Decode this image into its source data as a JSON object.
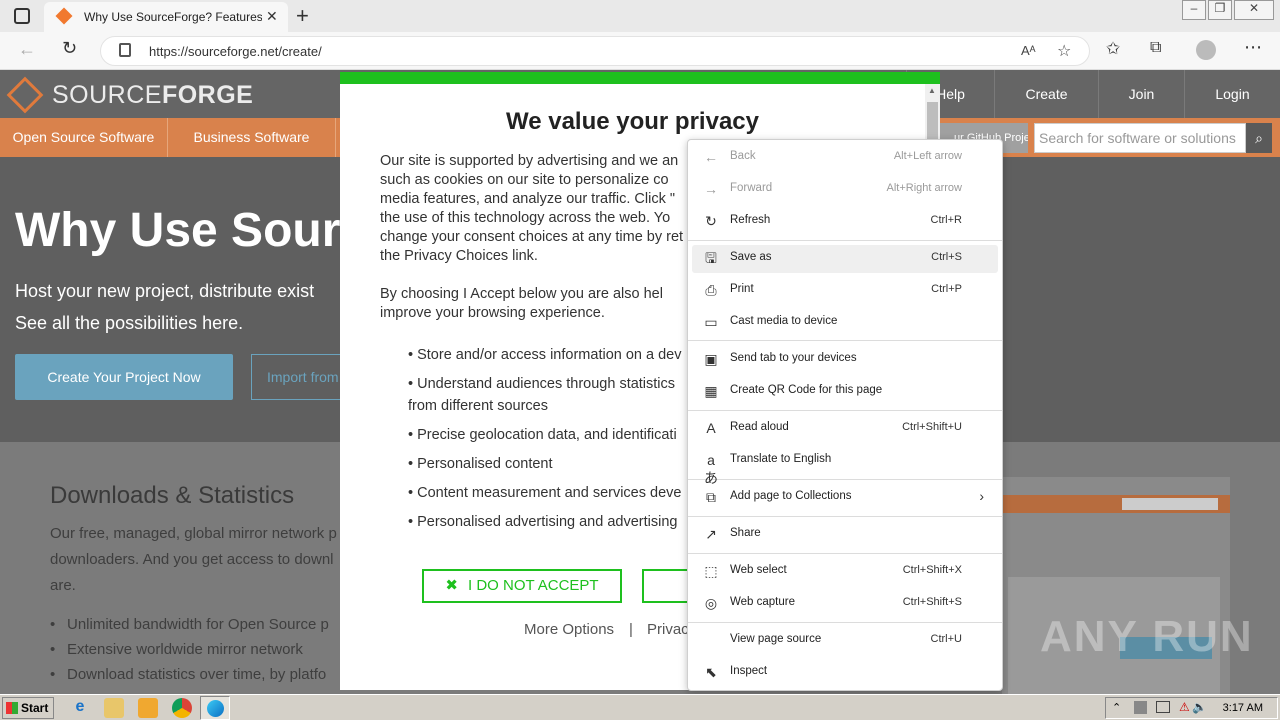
{
  "browser": {
    "tab_title": "Why Use SourceForge? Features a",
    "url": "https://sourceforge.net/create/"
  },
  "site": {
    "logo_text_light": "SOURCE",
    "logo_text_bold": "FORGE",
    "top_nav": [
      "Help",
      "Create",
      "Join",
      "Login"
    ],
    "orange_nav": [
      "Open Source Software",
      "Business Software"
    ],
    "github_project": "ur GitHub Project",
    "search_placeholder": "Search for software or solutions",
    "hero_title": "Why Use Sourc",
    "hero_line1": "Host your new project, distribute exist",
    "hero_line2": "See all the possibilities here.",
    "create_button": "Create Your Project Now",
    "import_button": "Import from",
    "downloads_title": "Downloads & Statistics",
    "downloads_text": [
      "Our free, managed, global mirror network p",
      "downloaders. And you get access to downl",
      "are."
    ],
    "bullets": [
      "Unlimited bandwidth for Open Source p",
      "Extensive worldwide mirror network",
      "Download statistics over time, by platfo"
    ]
  },
  "modal": {
    "title": "We value your privacy",
    "paragraph1": [
      "Our site is supported by advertising and we an",
      "such as cookies on our site to personalize co",
      "media features, and analyze our traffic. Click \"",
      "the use of this technology across the web. Yo",
      "change your consent choices at any time by ret",
      "the Privacy Choices link."
    ],
    "paragraph2": [
      "By choosing I Accept below you are also hel",
      "improve your browsing experience."
    ],
    "bullets": [
      "• Store and/or access information on a dev",
      "• Understand audiences through statistics",
      "from different sources",
      "• Precise geolocation data, and identificati",
      "• Personalised content",
      "• Content measurement and services deve",
      "• Personalised advertising and advertising"
    ],
    "do_not_accept": "I DO NOT ACCEPT",
    "more_options": "More Options",
    "separator": "|",
    "privacy": "Privac"
  },
  "context_menu": {
    "items": [
      {
        "label": "Back",
        "shortcut": "Alt+Left arrow",
        "icon": "back-arrow-icon",
        "glyph": "←",
        "disabled": true
      },
      {
        "label": "Forward",
        "shortcut": "Alt+Right arrow",
        "icon": "forward-arrow-icon",
        "glyph": "→",
        "disabled": true
      },
      {
        "label": "Refresh",
        "shortcut": "Ctrl+R",
        "icon": "refresh-icon",
        "glyph": "↻"
      },
      {
        "label": "Save as",
        "shortcut": "Ctrl+S",
        "icon": "save-icon",
        "glyph": "🖫"
      },
      {
        "label": "Print",
        "shortcut": "Ctrl+P",
        "icon": "print-icon",
        "glyph": "⎙"
      },
      {
        "label": "Cast media to device",
        "shortcut": "",
        "icon": "cast-icon",
        "glyph": "▭"
      },
      {
        "label": "Send tab to your devices",
        "shortcut": "",
        "icon": "send-tab-icon",
        "glyph": "▣"
      },
      {
        "label": "Create QR Code for this page",
        "shortcut": "",
        "icon": "qr-code-icon",
        "glyph": "▦"
      },
      {
        "label": "Read aloud",
        "shortcut": "Ctrl+Shift+U",
        "icon": "read-aloud-icon",
        "glyph": "A"
      },
      {
        "label": "Translate to English",
        "shortcut": "",
        "icon": "translate-icon",
        "glyph": "aあ"
      },
      {
        "label": "Add page to Collections",
        "shortcut": "",
        "icon": "collections-icon",
        "glyph": "⧉",
        "submenu": true
      },
      {
        "label": "Share",
        "shortcut": "",
        "icon": "share-icon",
        "glyph": "↗"
      },
      {
        "label": "Web select",
        "shortcut": "Ctrl+Shift+X",
        "icon": "web-select-icon",
        "glyph": "⬚"
      },
      {
        "label": "Web capture",
        "shortcut": "Ctrl+Shift+S",
        "icon": "web-capture-icon",
        "glyph": "◎"
      },
      {
        "label": "View page source",
        "shortcut": "Ctrl+U",
        "icon": "",
        "glyph": ""
      },
      {
        "label": "Inspect",
        "shortcut": "",
        "icon": "inspect-icon",
        "glyph": "⬉"
      }
    ]
  },
  "taskbar": {
    "start_label": "Start",
    "clock": "3:17 AM"
  },
  "watermark": "ANY RUN"
}
